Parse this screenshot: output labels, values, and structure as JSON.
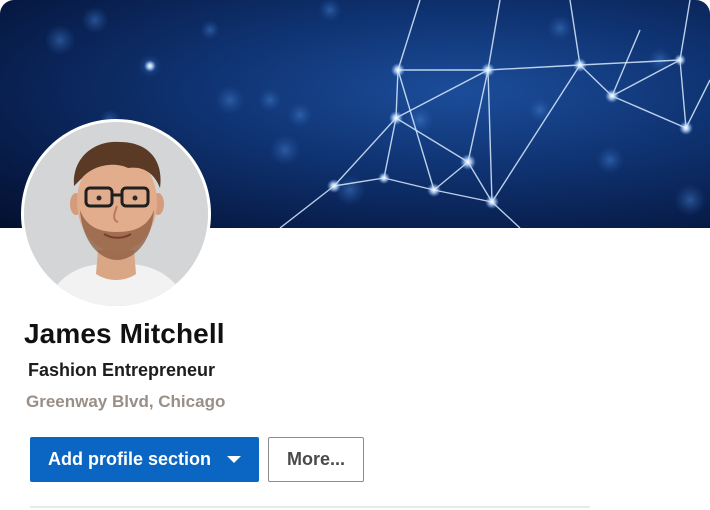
{
  "profile": {
    "name": "James Mitchell",
    "headline": "Fashion Entrepreneur",
    "location": "Greenway Blvd, Chicago"
  },
  "actions": {
    "add_section_label": "Add profile section",
    "more_label": "More..."
  },
  "icons": {
    "dropdown": "chevron-down-icon"
  },
  "colors": {
    "primary_button": "#0a66c2",
    "banner_dark": "#071a45",
    "location_text": "#9a8f87"
  }
}
